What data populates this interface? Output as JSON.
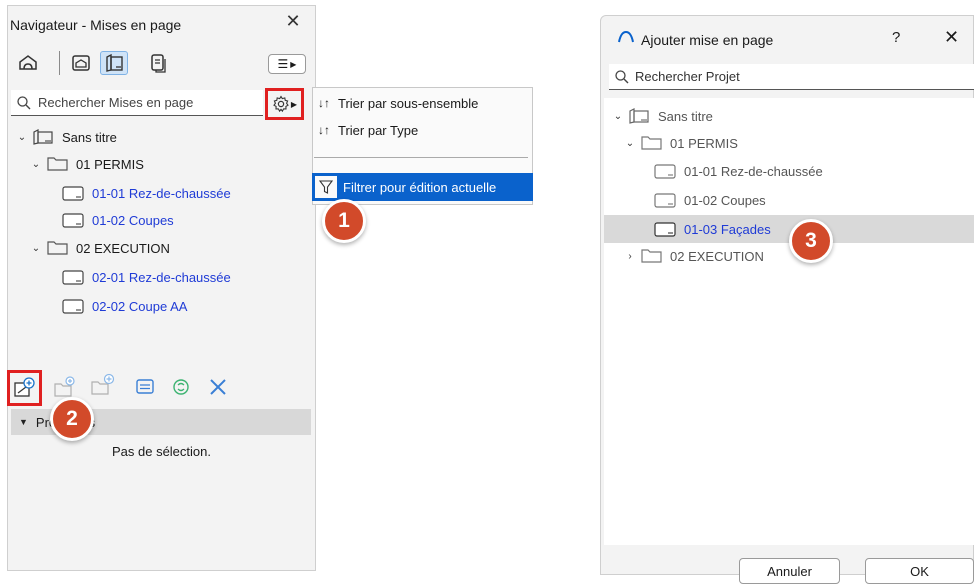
{
  "navigator": {
    "title": "Navigateur - Mises en page",
    "search_placeholder": "Rechercher Mises en page",
    "tree": [
      {
        "label": "Sans titre"
      },
      {
        "label": "01 PERMIS"
      },
      {
        "label": "01-01 Rez-de-chaussée"
      },
      {
        "label": "01-02 Coupes"
      },
      {
        "label": "02 EXECUTION"
      },
      {
        "label": "02-01 Rez-de-chaussée"
      },
      {
        "label": "02-02 Coupe AA"
      }
    ],
    "properties_header": "Propriétés",
    "no_selection": "Pas de sélection."
  },
  "context_menu": {
    "sort_subset": "Trier par sous-ensemble",
    "sort_type": "Trier par Type",
    "filter_current": "Filtrer pour édition actuelle"
  },
  "dialog": {
    "title": "Ajouter mise en page",
    "help": "?",
    "search_placeholder": "Rechercher Projet",
    "tree": [
      {
        "label": "Sans titre"
      },
      {
        "label": "01 PERMIS"
      },
      {
        "label": "01-01 Rez-de-chaussée"
      },
      {
        "label": "01-02 Coupes"
      },
      {
        "label": "01-03 Façades"
      },
      {
        "label": "02 EXECUTION"
      }
    ],
    "cancel_label": "Annuler",
    "ok_label": "OK"
  },
  "badges": [
    "1",
    "2",
    "3"
  ],
  "colors": {
    "accent_blue": "#0a62cc",
    "link_blue": "#1f3bd6",
    "highlight_red": "#e02020",
    "badge": "#d24a2a",
    "add_icon_blue": "#1a73c9",
    "refresh_green": "#3cb371",
    "delete_blue": "#3a7fd5"
  }
}
